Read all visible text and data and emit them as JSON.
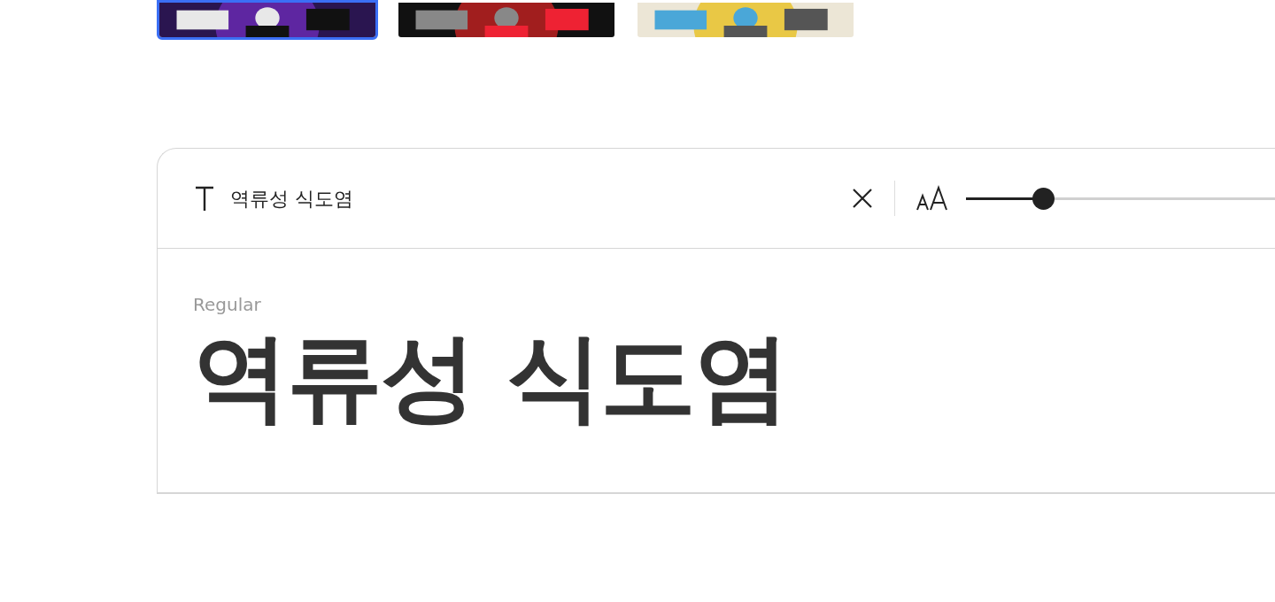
{
  "thumbnails": [
    {
      "kind": "picture",
      "selected": true
    },
    {
      "kind": "picture",
      "selected": false
    },
    {
      "kind": "picture",
      "selected": false
    }
  ],
  "preview_card": {
    "text_field": {
      "value": "역류성 식도염"
    },
    "size_slider": {
      "level": 0.25
    },
    "samples": [
      {
        "style": "Regular",
        "text": "역류성 식도염"
      }
    ]
  }
}
